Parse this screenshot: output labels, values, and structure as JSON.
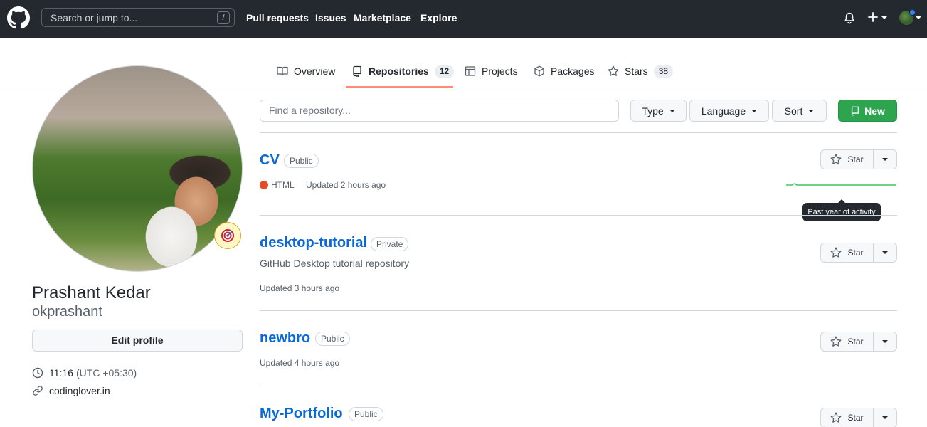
{
  "header": {
    "search_placeholder": "Search or jump to...",
    "search_shortcut": "/",
    "nav": [
      "Pull requests",
      "Issues",
      "Marketplace",
      "Explore"
    ]
  },
  "tabs": [
    {
      "label": "Overview",
      "icon": "book-icon"
    },
    {
      "label": "Repositories",
      "icon": "repo-icon",
      "count": "12",
      "active": true
    },
    {
      "label": "Projects",
      "icon": "table-icon"
    },
    {
      "label": "Packages",
      "icon": "package-icon"
    },
    {
      "label": "Stars",
      "icon": "star-icon",
      "count": "38"
    }
  ],
  "profile": {
    "full_name": "Prashant Kedar",
    "login": "okprashant",
    "edit_label": "Edit profile",
    "time": "11:16",
    "timezone": "(UTC +05:30)",
    "website": "codinglover.in"
  },
  "filters": {
    "find_placeholder": "Find a repository...",
    "type_label": "Type",
    "language_label": "Language",
    "sort_label": "Sort",
    "new_label": "New"
  },
  "repos": [
    {
      "name": "CV",
      "visibility": "Public",
      "language": "HTML",
      "language_color": "#e34c26",
      "updated": "Updated 2 hours ago"
    },
    {
      "name": "desktop-tutorial",
      "visibility": "Private",
      "description": "GitHub Desktop tutorial repository",
      "updated": "Updated 3 hours ago"
    },
    {
      "name": "newbro",
      "visibility": "Public",
      "updated": "Updated 4 hours ago"
    },
    {
      "name": "My-Portfolio",
      "visibility": "Public"
    }
  ],
  "star_label": "Star",
  "tooltip": "Past year of activity",
  "colors": {
    "accent_link": "#0969da",
    "new_button": "#2da44e",
    "header_bg": "#24292f",
    "tab_underline": "#fd8c73",
    "activity_line": "#40c463"
  }
}
